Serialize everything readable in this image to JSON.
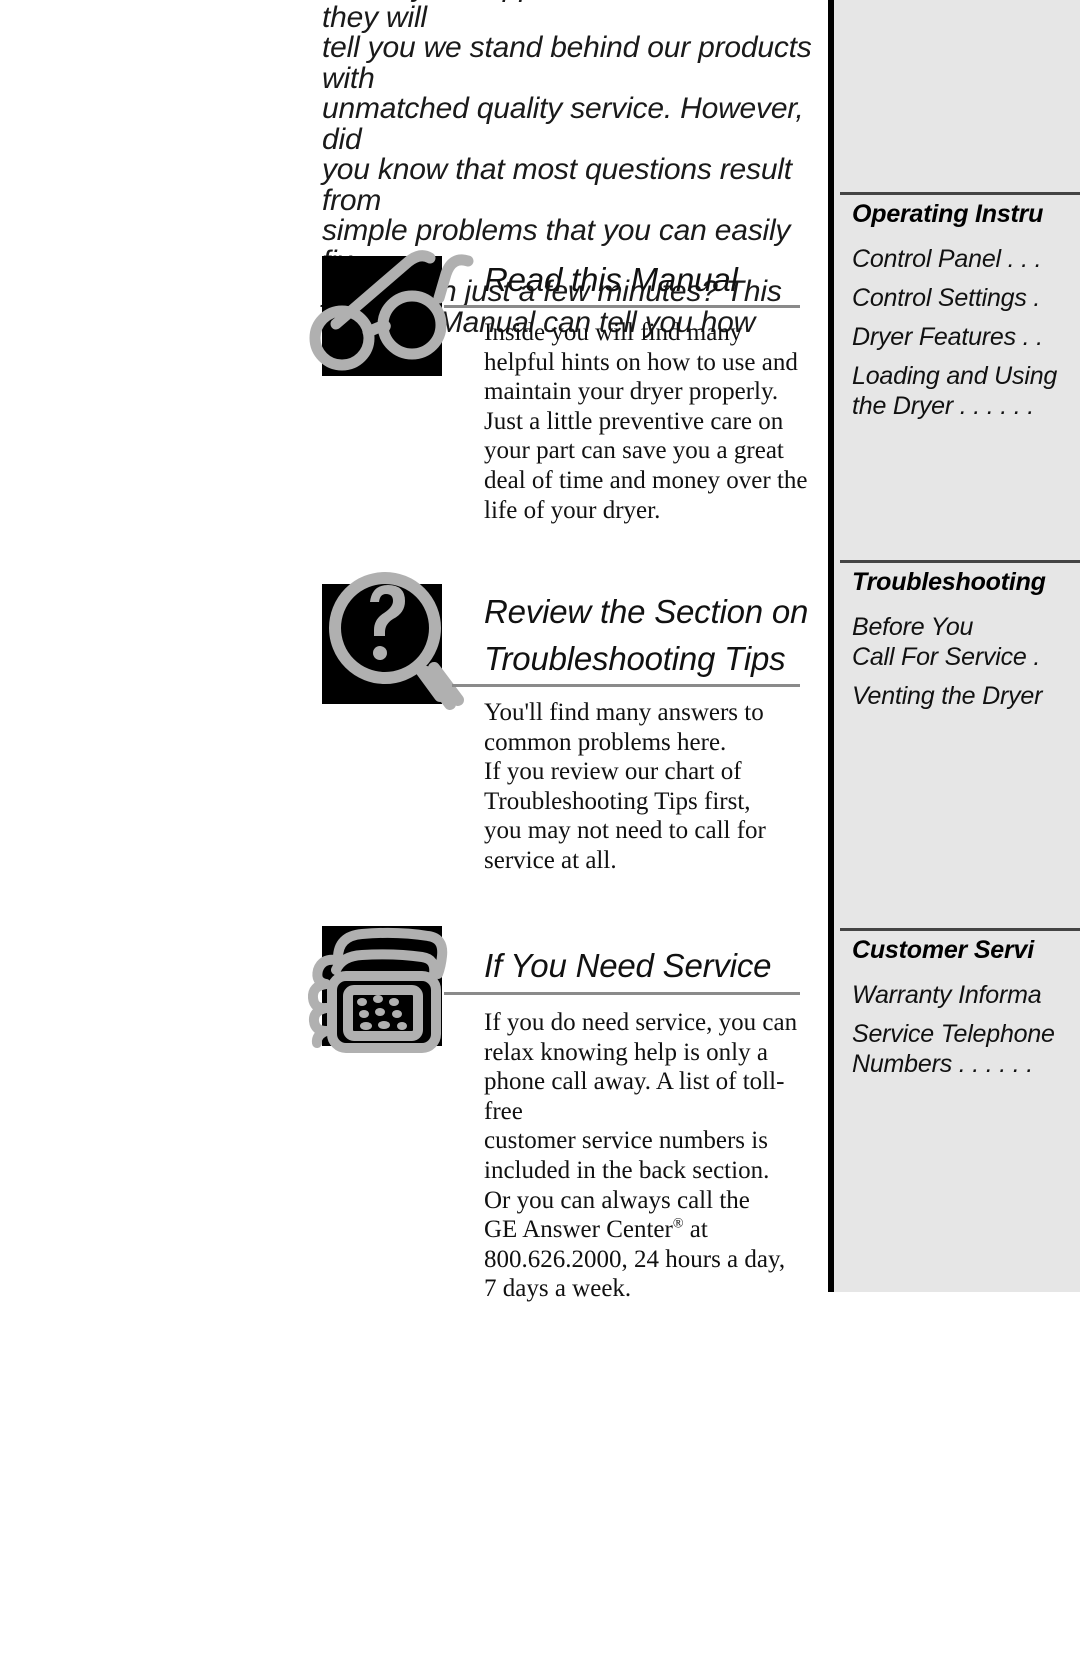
{
  "intro": {
    "paragraph": "Ask any GE appliance owner and they will\ntell you we stand behind our products with\nunmatched quality service. However, did\nyou know that most questions result from\nsimple problems that you can easily fix\nyourself in just a few minutes? This\nOwner's Manual can tell you how"
  },
  "sections": [
    {
      "icon": "eyeglasses-icon",
      "heading": "Read this Manual",
      "body": "Inside you will find many\nhelpful hints on how to use and\nmaintain your dryer properly.\nJust a little preventive care on\nyour part can save you a great\ndeal of time and money over the\nlife of your dryer."
    },
    {
      "icon": "magnifying-glass-question-icon",
      "heading": "Review the Section on\nTroubleshooting Tips",
      "body": "You'll find many answers to\ncommon problems here.\nIf you review our chart of\nTroubleshooting Tips first,\nyou may not need to call for\nservice at all."
    },
    {
      "icon": "telephone-icon",
      "heading": "If  You Need Service",
      "body_part1": "If you do need service, you can\nrelax knowing help is only a\nphone call away. A list of toll-free\ncustomer service numbers is\nincluded in the back section.\nOr you can always call the\nGE Answer Center",
      "body_sup": "®",
      "body_part2": " at\n800.626.2000, 24 hours a day,\n7 days a week."
    }
  ],
  "sidebar": {
    "sections": [
      {
        "title": "Operating Instru",
        "entries": [
          "Control Panel  . . .",
          "Control Settings .",
          "Dryer Features  . .",
          "Loading and Using\nthe Dryer  . . . . . ."
        ]
      },
      {
        "title": "Troubleshooting",
        "entries": [
          "Before You\nCall For Service  .",
          "Venting the Dryer"
        ]
      },
      {
        "title": "Customer Servi",
        "entries": [
          "Warranty Informa",
          "Service Telephone\nNumbers  . . . . . ."
        ]
      }
    ]
  },
  "colors": {
    "icon_box": "#000000",
    "icon_stroke": "#b0b0b0",
    "sidebar_bg": "#e6e6e6",
    "sidebar_border": "#000000",
    "rule": "#8a8a8a",
    "text": "#111111"
  }
}
